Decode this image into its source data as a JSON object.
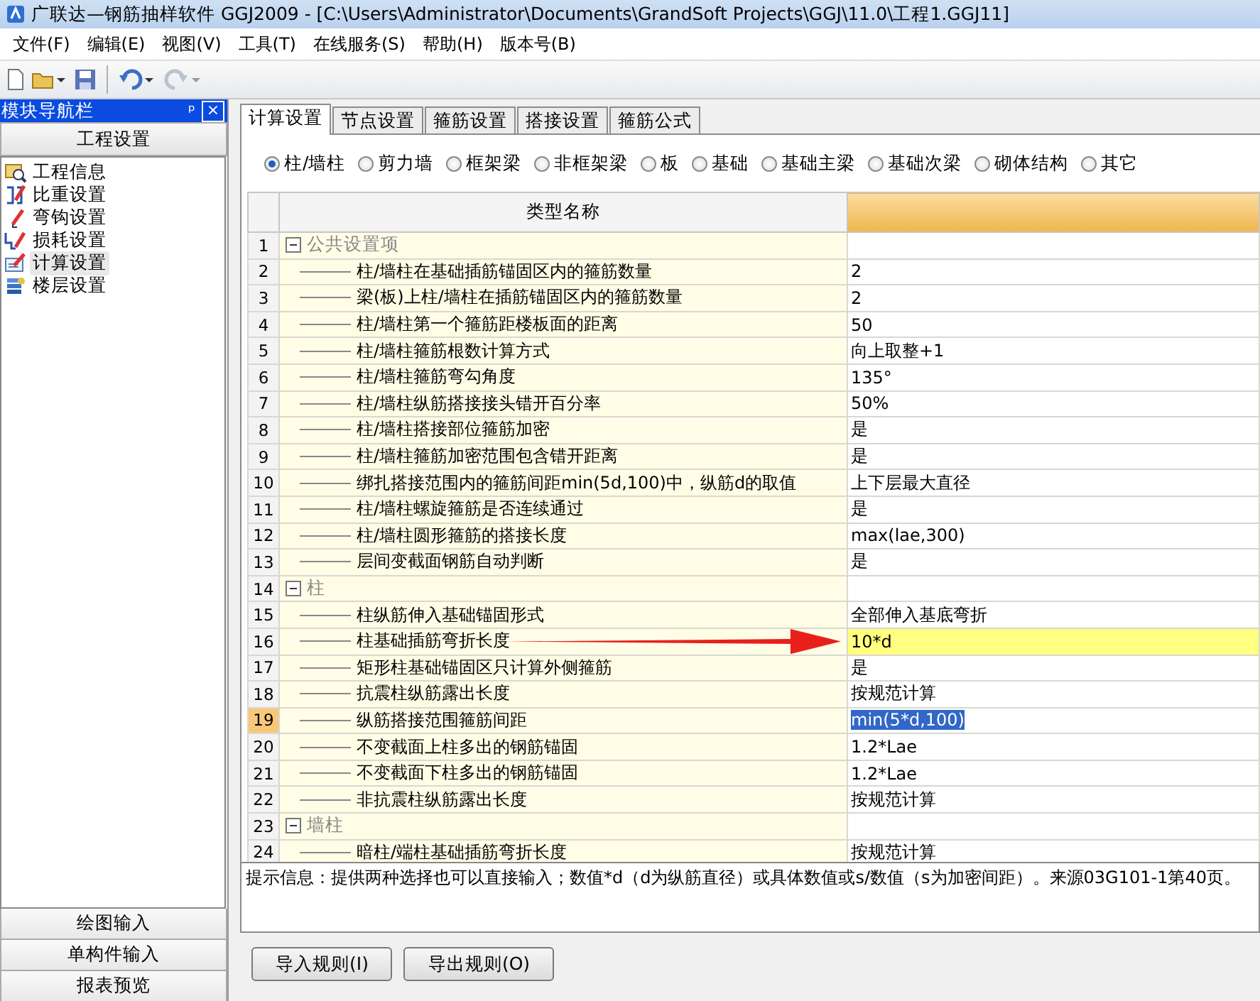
{
  "window": {
    "title": "广联达—钢筋抽样软件 GGJ2009 - [C:\\Users\\Administrator\\Documents\\GrandSoft Projects\\GGJ\\11.0\\工程1.GGJ11]"
  },
  "menu": [
    "文件(F)",
    "编辑(E)",
    "视图(V)",
    "工具(T)",
    "在线服务(S)",
    "帮助(H)",
    "版本号(B)"
  ],
  "nav": {
    "title": "模块导航栏",
    "pin": "ᵖ",
    "close": "×",
    "section": "工程设置",
    "items": [
      {
        "label": "工程信息",
        "selected": false
      },
      {
        "label": "比重设置",
        "selected": false
      },
      {
        "label": "弯钩设置",
        "selected": false
      },
      {
        "label": "损耗设置",
        "selected": false
      },
      {
        "label": "计算设置",
        "selected": true
      },
      {
        "label": "楼层设置",
        "selected": false
      }
    ],
    "bottom": [
      "绘图输入",
      "单构件输入",
      "报表预览"
    ]
  },
  "tabs": [
    {
      "label": "计算设置",
      "selected": true
    },
    {
      "label": "节点设置",
      "selected": false
    },
    {
      "label": "箍筋设置",
      "selected": false
    },
    {
      "label": "搭接设置",
      "selected": false
    },
    {
      "label": "箍筋公式",
      "selected": false
    }
  ],
  "radios": [
    {
      "label": "柱/墙柱",
      "selected": true
    },
    {
      "label": "剪力墙",
      "selected": false
    },
    {
      "label": "框架梁",
      "selected": false
    },
    {
      "label": "非框架梁",
      "selected": false
    },
    {
      "label": "板",
      "selected": false
    },
    {
      "label": "基础",
      "selected": false
    },
    {
      "label": "基础主梁",
      "selected": false
    },
    {
      "label": "基础次梁",
      "selected": false
    },
    {
      "label": "砌体结构",
      "selected": false
    },
    {
      "label": "其它",
      "selected": false
    }
  ],
  "table": {
    "columns": [
      "类型名称"
    ],
    "groups": [
      {
        "num": "1",
        "label": "公共设置项",
        "expanded": true,
        "children": [
          {
            "num": "2",
            "name": "柱/墙柱在基础插筋锚固区内的箍筋数量",
            "value": "2",
            "selected": false,
            "highlighted": false
          },
          {
            "num": "3",
            "name": "梁(板)上柱/墙柱在插筋锚固区内的箍筋数量",
            "value": "2",
            "selected": false,
            "highlighted": false
          },
          {
            "num": "4",
            "name": "柱/墙柱第一个箍筋距楼板面的距离",
            "value": "50",
            "selected": false,
            "highlighted": false
          },
          {
            "num": "5",
            "name": "柱/墙柱箍筋根数计算方式",
            "value": "向上取整+1",
            "selected": false,
            "highlighted": false
          },
          {
            "num": "6",
            "name": "柱/墙柱箍筋弯勾角度",
            "value": "135°",
            "selected": false,
            "highlighted": false
          },
          {
            "num": "7",
            "name": "柱/墙柱纵筋搭接接头错开百分率",
            "value": "50%",
            "selected": false,
            "highlighted": false
          },
          {
            "num": "8",
            "name": "柱/墙柱搭接部位箍筋加密",
            "value": "是",
            "selected": false,
            "highlighted": false
          },
          {
            "num": "9",
            "name": "柱/墙柱箍筋加密范围包含错开距离",
            "value": "是",
            "selected": false,
            "highlighted": false
          },
          {
            "num": "10",
            "name": "绑扎搭接范围内的箍筋间距min(5d,100)中，纵筋d的取值",
            "value": "上下层最大直径",
            "selected": false,
            "highlighted": false
          },
          {
            "num": "11",
            "name": "柱/墙柱螺旋箍筋是否连续通过",
            "value": "是",
            "selected": false,
            "highlighted": false
          },
          {
            "num": "12",
            "name": "柱/墙柱圆形箍筋的搭接长度",
            "value": "max(lae,300)",
            "selected": false,
            "highlighted": false
          },
          {
            "num": "13",
            "name": "层间变截面钢筋自动判断",
            "value": "是",
            "selected": false,
            "highlighted": false
          }
        ]
      },
      {
        "num": "14",
        "label": "柱",
        "expanded": true,
        "children": [
          {
            "num": "15",
            "name": "柱纵筋伸入基础锚固形式",
            "value": "全部伸入基底弯折",
            "selected": false,
            "highlighted": false
          },
          {
            "num": "16",
            "name": "柱基础插筋弯折长度",
            "value": "10*d",
            "selected": false,
            "highlighted": true
          },
          {
            "num": "17",
            "name": "矩形柱基础锚固区只计算外侧箍筋",
            "value": "是",
            "selected": false,
            "highlighted": false
          },
          {
            "num": "18",
            "name": "抗震柱纵筋露出长度",
            "value": "按规范计算",
            "selected": false,
            "highlighted": false
          },
          {
            "num": "19",
            "name": "纵筋搭接范围箍筋间距",
            "value": "min(5*d,100)",
            "selected": true,
            "highlighted": false
          },
          {
            "num": "20",
            "name": "不变截面上柱多出的钢筋锚固",
            "value": "1.2*Lae",
            "selected": false,
            "highlighted": false
          },
          {
            "num": "21",
            "name": "不变截面下柱多出的钢筋锚固",
            "value": "1.2*Lae",
            "selected": false,
            "highlighted": false
          },
          {
            "num": "22",
            "name": "非抗震柱纵筋露出长度",
            "value": "按规范计算",
            "selected": false,
            "highlighted": false
          }
        ]
      },
      {
        "num": "23",
        "label": "墙柱",
        "expanded": true,
        "children": [
          {
            "num": "24",
            "name": "暗柱/端柱基础插筋弯折长度",
            "value": "按规范计算",
            "selected": false,
            "highlighted": false
          }
        ]
      }
    ]
  },
  "hint": "提示信息：提供两种选择也可以直接输入；数值*d（d为纵筋直径）或具体数值或s/数值（s为加密间距）。来源03G101-1第40页。",
  "buttons": [
    "导入规则(I)",
    "导出规则(O)"
  ]
}
